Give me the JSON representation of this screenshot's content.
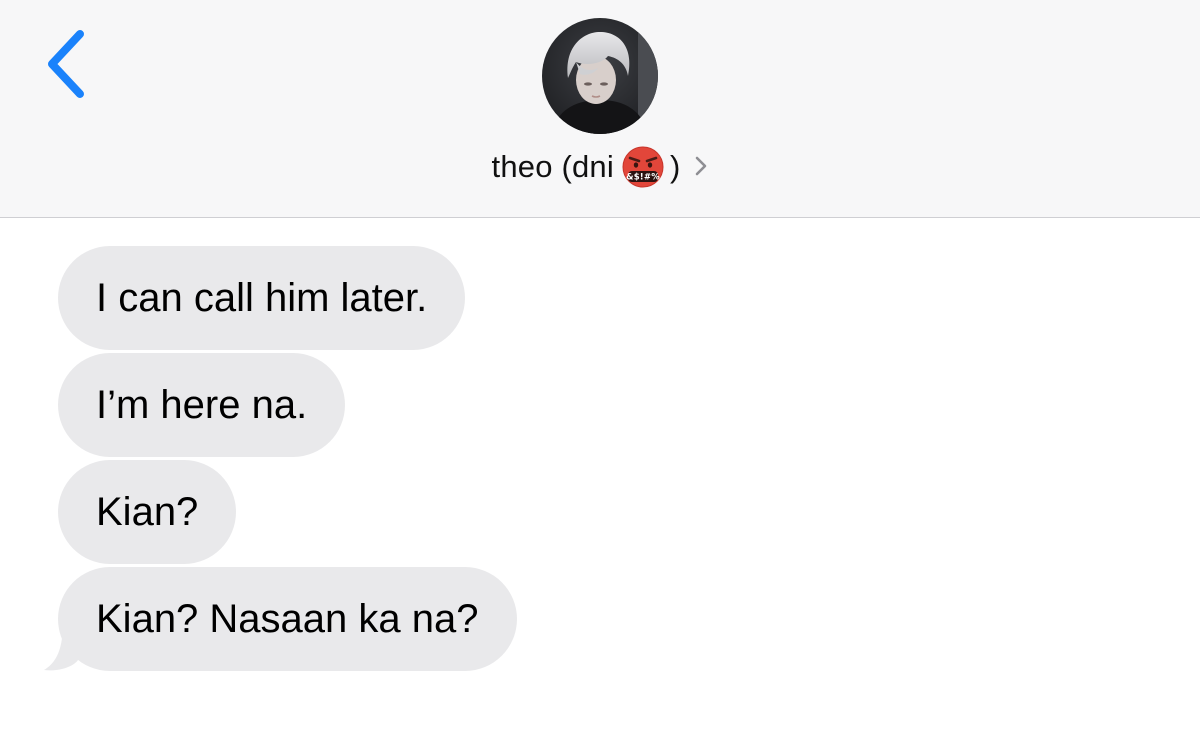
{
  "header": {
    "back_label": "Back",
    "contact_name": "theo (dni",
    "contact_name_suffix": ")",
    "emoji_badge_icon": "face-with-symbols-on-mouth-emoji",
    "chevron_icon": "chevron-right-icon"
  },
  "colors": {
    "accent": "#1a82fb",
    "bubble_incoming": "#e9e9eb",
    "header_bg": "#f7f7f8"
  },
  "messages": [
    {
      "text": "I can call him later."
    },
    {
      "text": "I’m here na."
    },
    {
      "text": "Kian?"
    },
    {
      "text": "Kian? Nasaan ka na?"
    }
  ]
}
